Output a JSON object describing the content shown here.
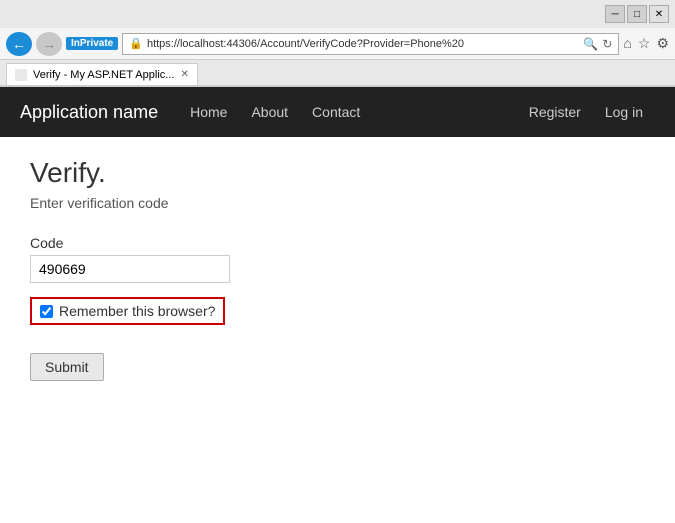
{
  "browser": {
    "title": "Verify - My ASP.NET Applic...",
    "url": "https://localhost:44306/Account/VerifyCode?Provider=Phone%20",
    "tab_label": "Verify - My ASP.NET Applic...",
    "inprivate_label": "InPrivate",
    "minimize_label": "─",
    "restore_label": "□",
    "close_label": "✕"
  },
  "navbar": {
    "brand": "Application name",
    "links": [
      {
        "label": "Home"
      },
      {
        "label": "About"
      },
      {
        "label": "Contact"
      }
    ],
    "right_links": [
      {
        "label": "Register"
      },
      {
        "label": "Log in"
      }
    ]
  },
  "page": {
    "title": "Verify.",
    "subtitle": "Enter verification code",
    "code_label": "Code",
    "code_value": "490669",
    "code_placeholder": "",
    "remember_label": "Remember this browser?",
    "submit_label": "Submit"
  }
}
